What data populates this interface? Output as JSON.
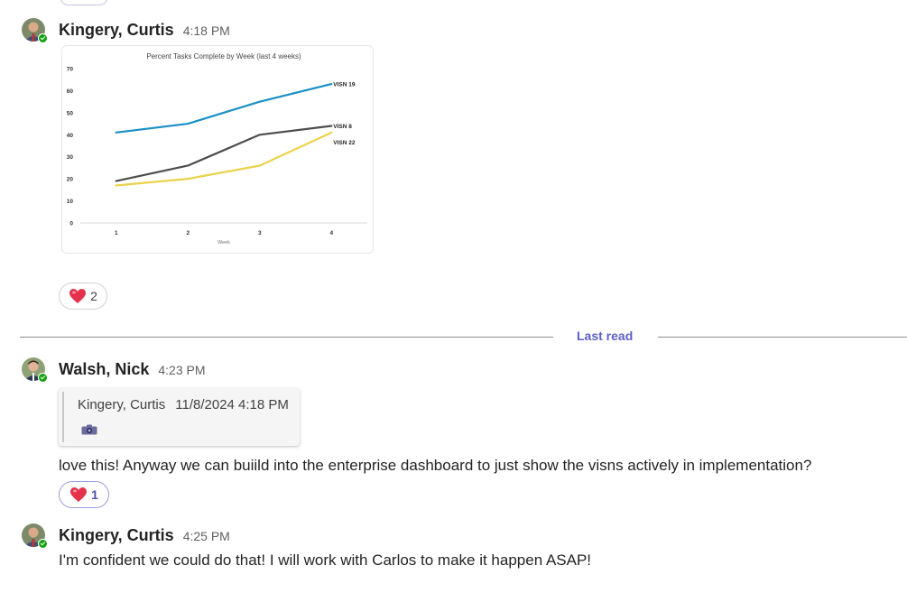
{
  "messages": [
    {
      "sender": "Kingery, Curtis",
      "time": "4:18 PM",
      "reaction": {
        "icon": "heart-icon",
        "count": "2"
      }
    },
    {
      "sender": "Walsh, Nick",
      "time": "4:23 PM",
      "quote": {
        "sender": "Kingery, Curtis",
        "timestamp": "11/8/2024 4:18 PM",
        "attachment_icon": "camera-icon"
      },
      "text": "love this! Anyway we can buiild into the enterprise dashboard to just show the visns actively in implementation?",
      "reaction": {
        "icon": "heart-icon",
        "count": "1"
      }
    },
    {
      "sender": "Kingery, Curtis",
      "time": "4:25 PM",
      "text": "I'm confident we could do that! I will work with Carlos to make it happen ASAP!"
    }
  ],
  "divider": {
    "label": "Last read"
  },
  "colors": {
    "accent": "#5b5fc7",
    "presence": "#13a10e",
    "heart": "#e3324a"
  },
  "chart_data": {
    "type": "line",
    "title": "Percent Tasks Complete by Week (last 4 weeks)",
    "xlabel": "Week",
    "ylabel": "",
    "x": [
      1,
      2,
      3,
      4
    ],
    "ylim": [
      0,
      70
    ],
    "yticks": [
      0,
      10,
      20,
      30,
      40,
      50,
      60,
      70
    ],
    "grid": false,
    "series": [
      {
        "name": "VISN 19",
        "values": [
          41,
          45,
          55,
          63
        ],
        "color": "#1a8fc4"
      },
      {
        "name": "VISN 8",
        "values": [
          19,
          26,
          40,
          44
        ],
        "color": "#4d4d4d"
      },
      {
        "name": "VISN 22",
        "values": [
          17,
          20,
          26,
          41
        ],
        "color": "#ecd24a"
      }
    ]
  }
}
